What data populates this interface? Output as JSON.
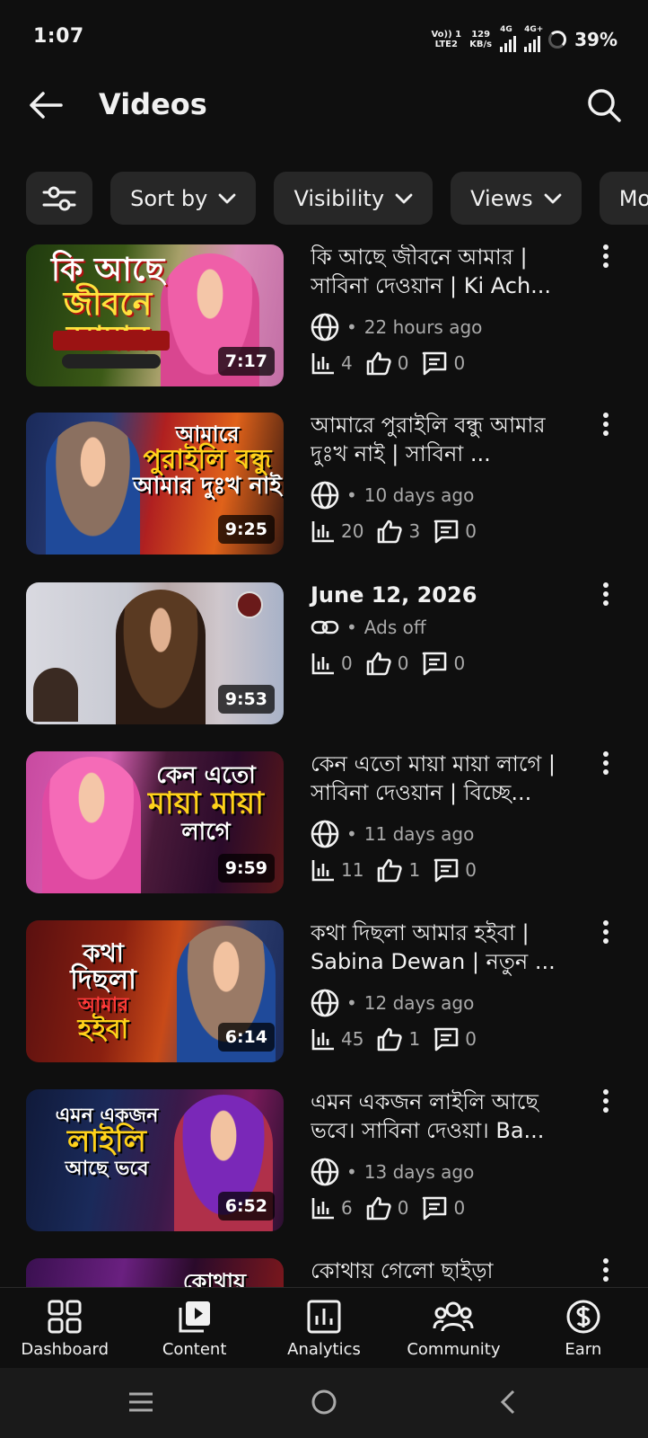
{
  "status_bar": {
    "time": "1:07",
    "volte": "Vo)) 1",
    "lte": "LTE2",
    "speed_value": "129",
    "speed_unit": "KB/s",
    "net1": "4G",
    "net2": "4G+",
    "battery": "39%"
  },
  "header": {
    "title": "Videos"
  },
  "filters": {
    "chips": [
      {
        "label": "Sort by"
      },
      {
        "label": "Visibility"
      },
      {
        "label": "Views"
      },
      {
        "label": "Monetization"
      }
    ]
  },
  "videos": [
    {
      "title": "কি আছে জীবনে আমার | সাবিনা দেওয়ান | Ki Ach...",
      "thumb_text": [
        "কি আছে",
        "জীবনে আমার"
      ],
      "duration": "7:17",
      "visibility_icon": "globe-icon",
      "meta": "22 hours ago",
      "views": "4",
      "likes": "0",
      "comments": "0"
    },
    {
      "title": "আমারে পুরাইলি বন্ধু আমার দুঃখ নাই | সাবিনা ...",
      "thumb_text": [
        "আমারে",
        "পুরাইলি বন্ধু",
        "আমার দুঃখ নাই"
      ],
      "duration": "9:25",
      "visibility_icon": "globe-icon",
      "meta": "10 days ago",
      "views": "20",
      "likes": "3",
      "comments": "0"
    },
    {
      "title": "June 12, 2026",
      "thumb_text": [],
      "duration": "9:53",
      "visibility_icon": "link-icon",
      "meta": "Ads off",
      "views": "0",
      "likes": "0",
      "comments": "0"
    },
    {
      "title": "কেন এতো মায়া মায়া লাগে | সাবিনা দেওয়ান | বিচ্ছে...",
      "thumb_text": [
        "কেন এতো",
        "মায়া মায়া",
        "লাগে"
      ],
      "duration": "9:59",
      "visibility_icon": "globe-icon",
      "meta": "11 days ago",
      "views": "11",
      "likes": "1",
      "comments": "0"
    },
    {
      "title": "কথা দিছলা আমার হইবা | Sabina Dewan | নতুন ...",
      "thumb_text": [
        "কথা",
        "দিছলা",
        "আমার",
        "হইবা"
      ],
      "duration": "6:14",
      "visibility_icon": "globe-icon",
      "meta": "12 days ago",
      "views": "45",
      "likes": "1",
      "comments": "0"
    },
    {
      "title": "এমন একজন লাইলি আছে ভবে। সাবিনা দেওয়া। Ba...",
      "thumb_text": [
        "এমন একজন",
        "লাইলি",
        "আছে ভবে"
      ],
      "duration": "6:52",
      "visibility_icon": "globe-icon",
      "meta": "13 days ago",
      "views": "6",
      "likes": "0",
      "comments": "0"
    },
    {
      "title": "কোথায় গেলো ছাইড়া",
      "thumb_text": [
        "কোথায়"
      ],
      "duration": "",
      "visibility_icon": "globe-icon",
      "meta": "",
      "views": "",
      "likes": "",
      "comments": ""
    }
  ],
  "bottom_nav": [
    {
      "label": "Dashboard",
      "icon": "dashboard-icon"
    },
    {
      "label": "Content",
      "icon": "content-icon"
    },
    {
      "label": "Analytics",
      "icon": "analytics-icon"
    },
    {
      "label": "Community",
      "icon": "community-icon"
    },
    {
      "label": "Earn",
      "icon": "earn-icon"
    }
  ],
  "colors": {
    "background": "#0f0f0f",
    "chip": "#272727",
    "text": "#f1f1f1",
    "muted": "#aaaaaa"
  }
}
